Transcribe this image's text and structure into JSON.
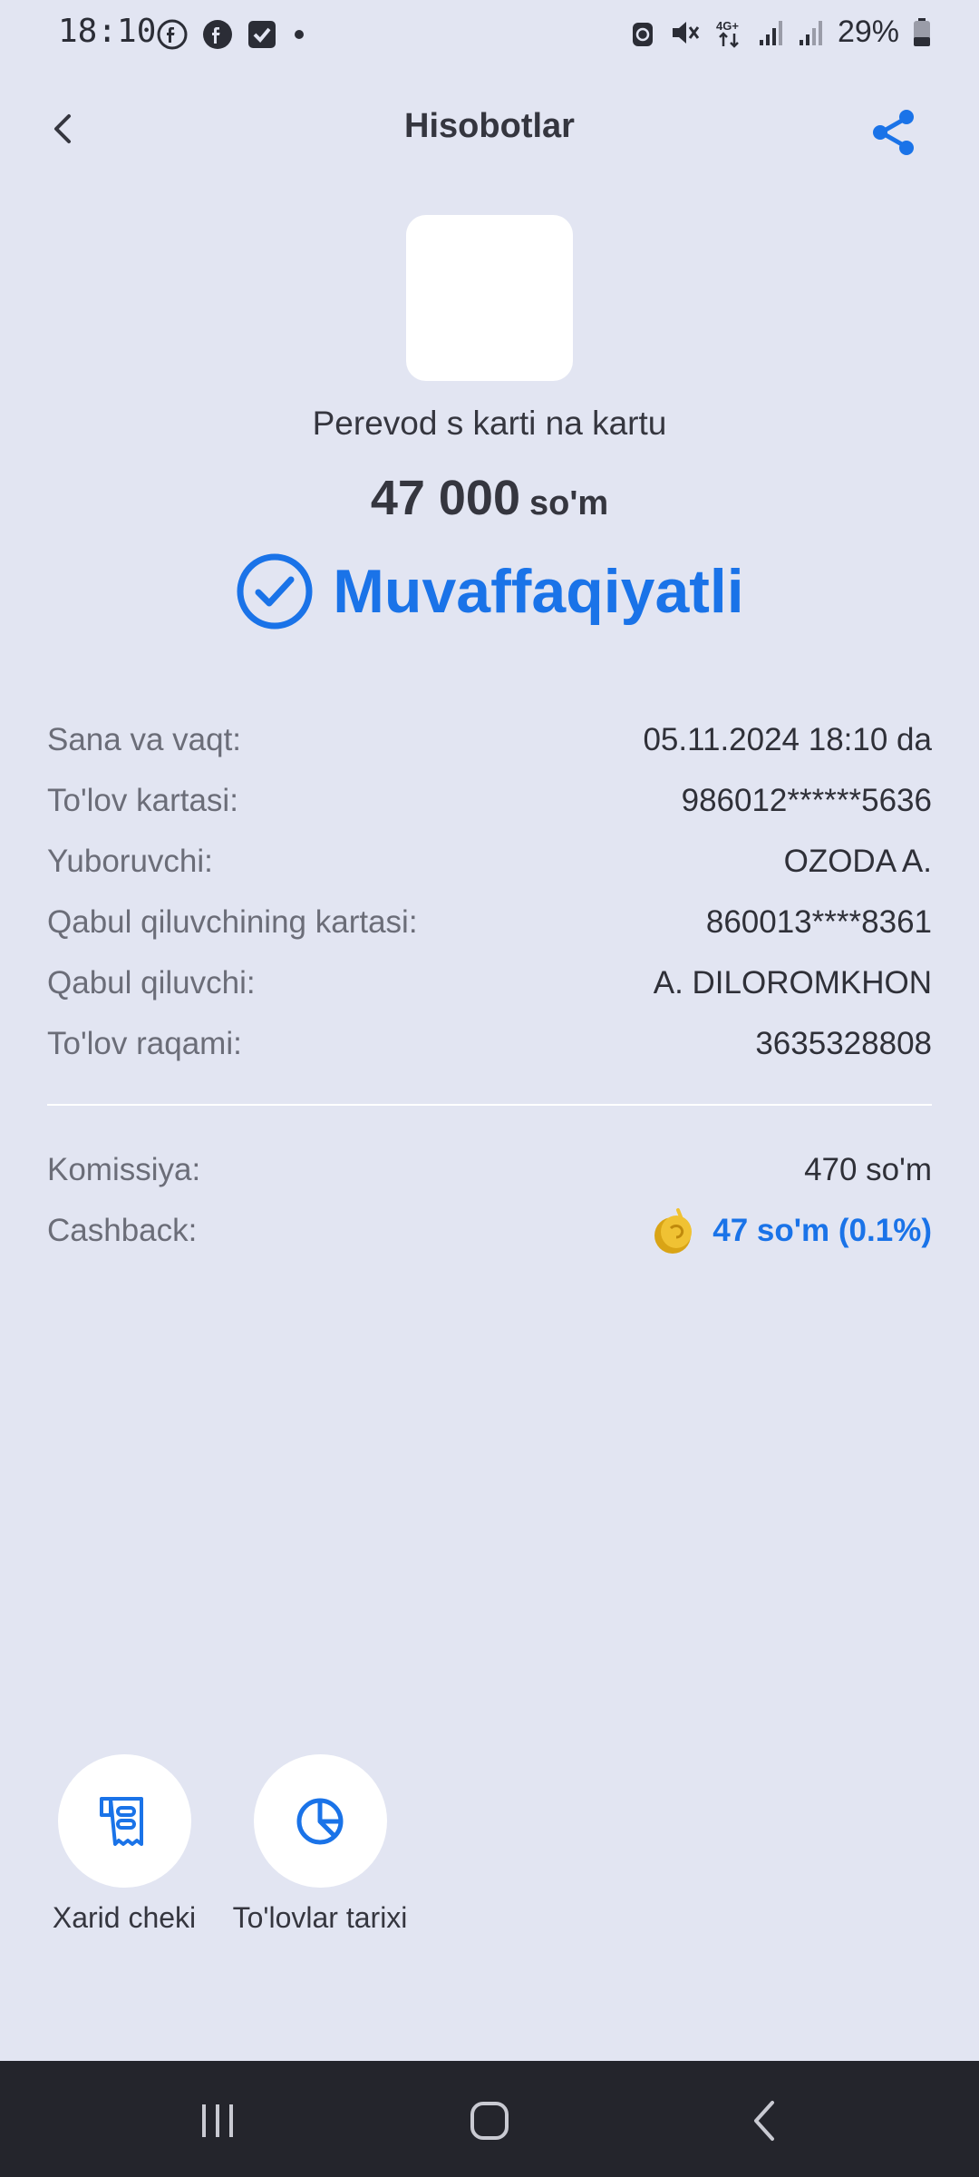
{
  "status_bar": {
    "time": "18:10",
    "battery": "29%",
    "left_icons": [
      "facebook-icon",
      "facebook-icon",
      "checkbox-icon",
      "dot-icon"
    ],
    "right_icons": [
      "alarm-icon",
      "mute-icon",
      "4g-icon",
      "signal-icon",
      "signal-icon",
      "battery-icon"
    ]
  },
  "header": {
    "title": "Hisobotlar",
    "back_icon": "chevron-left-icon",
    "share_icon": "share-icon"
  },
  "transaction": {
    "name": "Perevod s karti na kartu",
    "amount": "47 000",
    "currency": "so'm",
    "status": "Muvaffaqiyatli",
    "status_color": "#1a73e8"
  },
  "details": [
    {
      "label": "Sana va vaqt:",
      "value": "05.11.2024 18:10 da"
    },
    {
      "label": "To'lov kartasi:",
      "value": "986012******5636"
    },
    {
      "label": "Yuboruvchi:",
      "value": "OZODA A."
    },
    {
      "label": "Qabul qiluvchining kartasi:",
      "value": "860013****8361"
    },
    {
      "label": "Qabul qiluvchi:",
      "value": "A. DILOROMKHON"
    },
    {
      "label": "To'lov raqami:",
      "value": "3635328808"
    }
  ],
  "fees": {
    "commission_label": "Komissiya:",
    "commission_value": "470 so'm",
    "cashback_label": "Cashback:",
    "cashback_value": "47 so'm (0.1%)",
    "cashback_icon": "coin-icon"
  },
  "actions": [
    {
      "label": "Xarid cheki",
      "icon": "receipt-icon"
    },
    {
      "label": "To'lovlar tarixi",
      "icon": "pie-chart-icon"
    }
  ],
  "colors": {
    "background": "#e2e5f2",
    "accent": "#1a73e8",
    "nav_bar": "#24252c",
    "coin": "#e5b321"
  }
}
